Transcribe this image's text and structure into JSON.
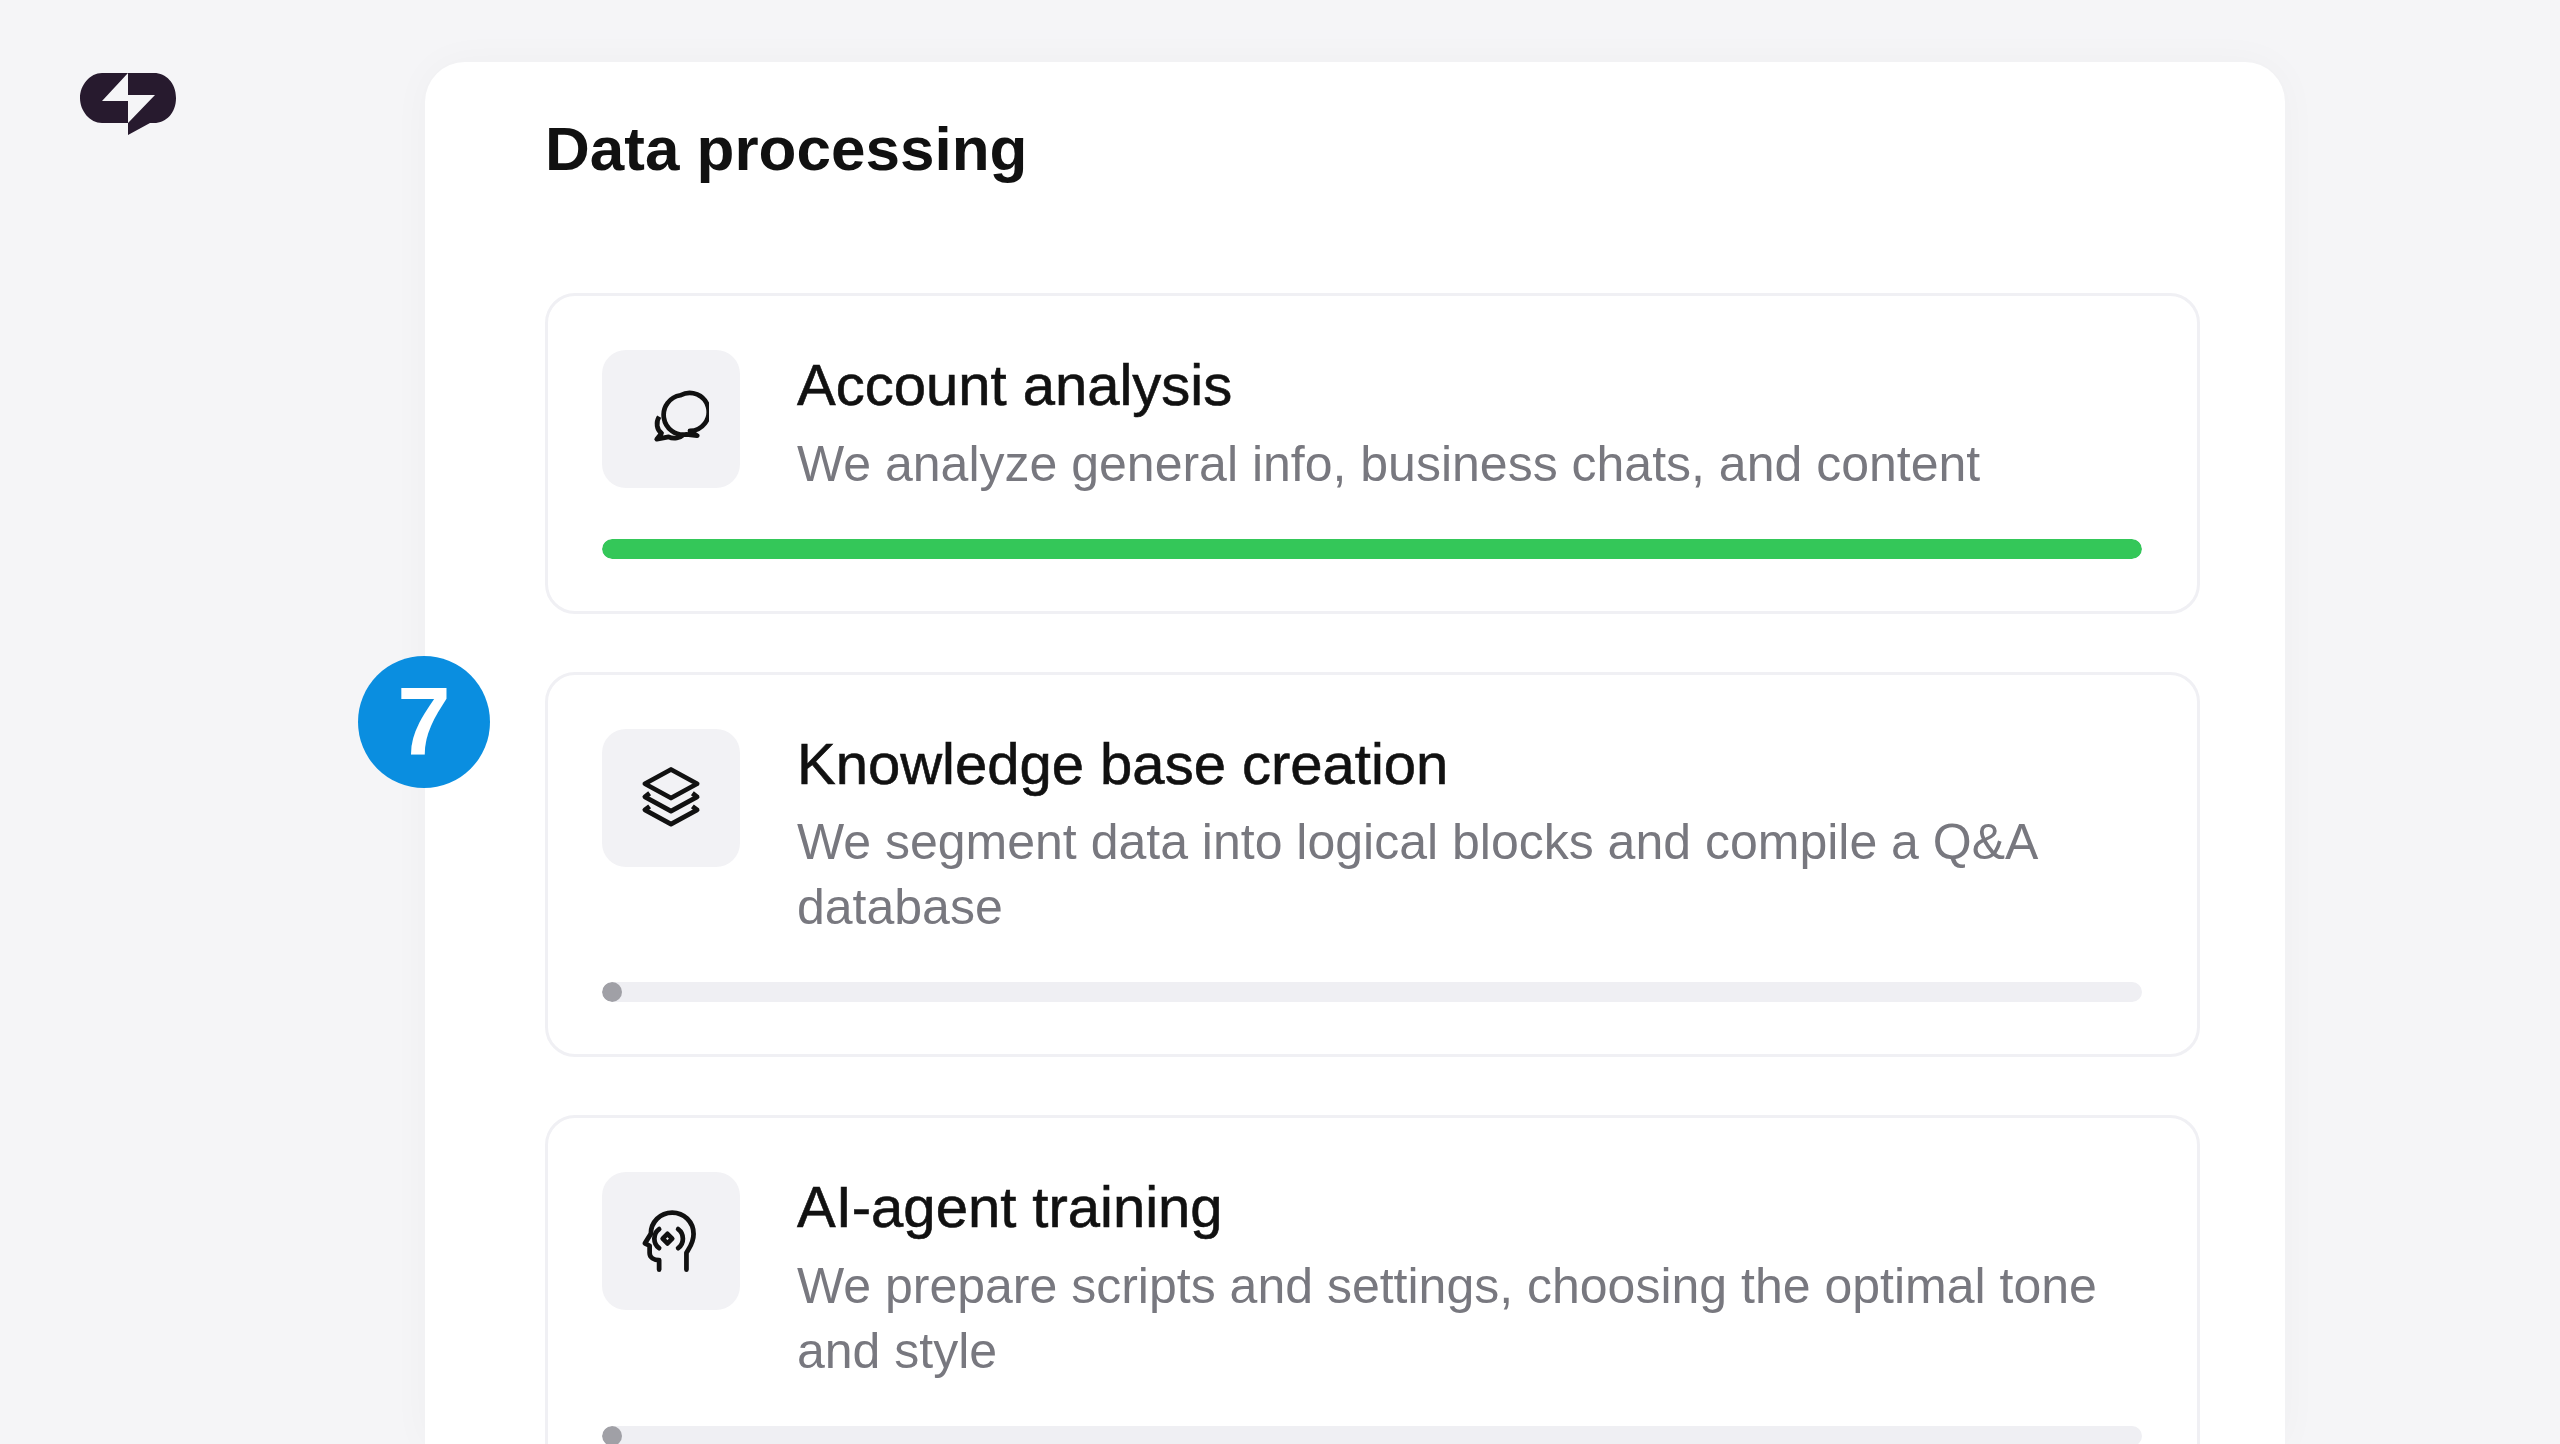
{
  "title": "Data processing",
  "step_badge": "7",
  "steps": [
    {
      "kind": "chats",
      "title": "Account analysis",
      "description": "We analyze general info, business chats, and content",
      "level": 1.0
    },
    {
      "kind": "layers",
      "title": "Knowledge base creation",
      "description": "We segment data into logical blocks and compile a Q&A database",
      "level": 0.01
    },
    {
      "kind": "head",
      "title": "AI-agent training",
      "description": "We prepare scripts and settings, choosing the optimal tone and style",
      "level": 0.01
    }
  ]
}
